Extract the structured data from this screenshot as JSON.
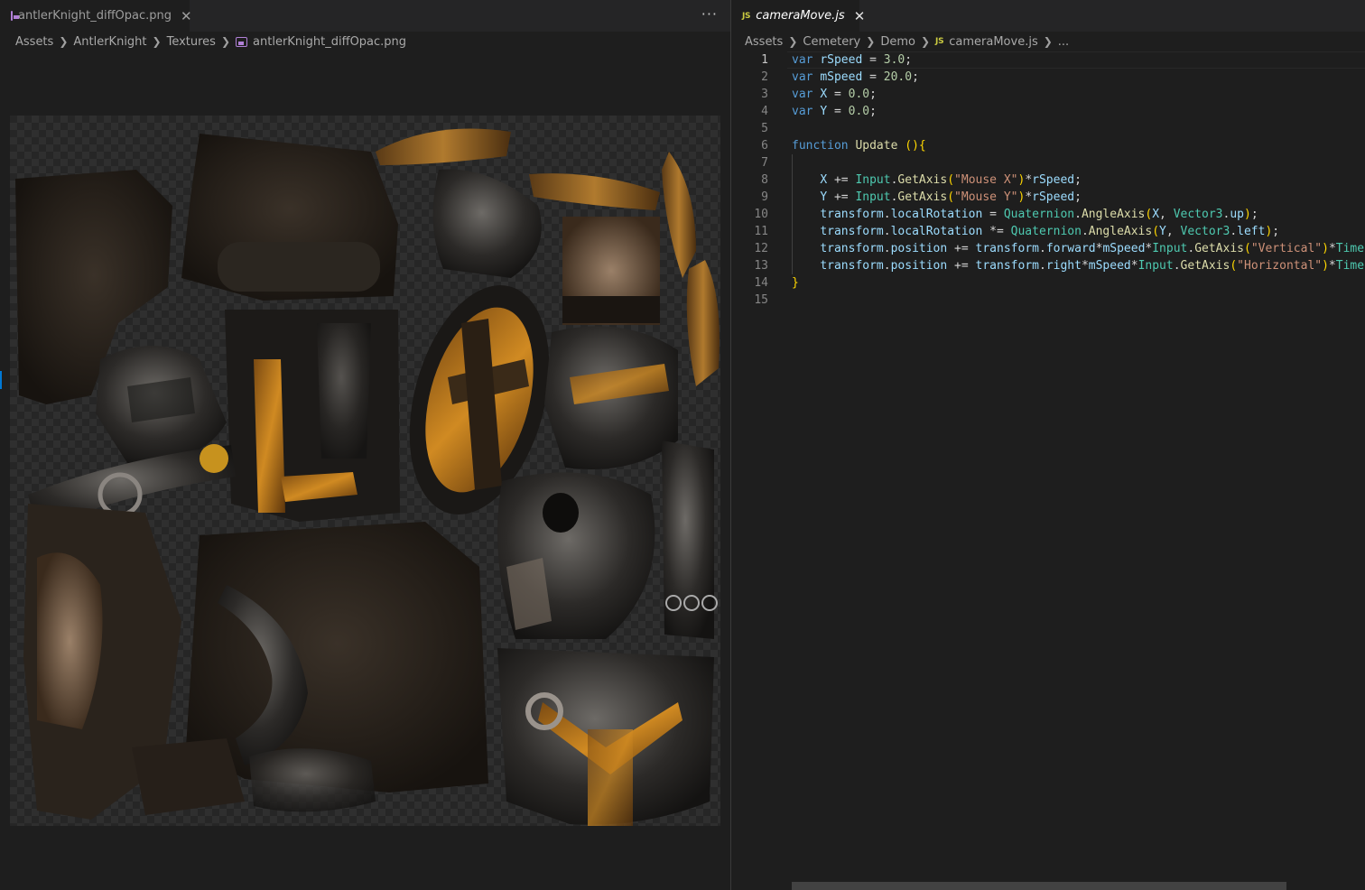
{
  "left_editor": {
    "tab": {
      "label": "antlerKnight_diffOpac.png",
      "icon": "image-file-icon"
    },
    "more_actions": "···",
    "breadcrumb": [
      "Assets",
      "AntlerKnight",
      "Textures",
      "antlerKnight_diffOpac.png"
    ],
    "image_alt": "antler knight diffuse opacity texture atlas"
  },
  "right_editor": {
    "tab": {
      "label": "cameraMove.js",
      "icon": "js-file-icon",
      "icon_text": "JS"
    },
    "breadcrumb": [
      "Assets",
      "Cemetery",
      "Demo",
      "cameraMove.js",
      "..."
    ],
    "active_line": 1,
    "lines": [
      {
        "num": "1",
        "text": "var rSpeed = 3.0;"
      },
      {
        "num": "2",
        "text": "var mSpeed = 20.0;"
      },
      {
        "num": "3",
        "text": "var X = 0.0;"
      },
      {
        "num": "4",
        "text": "var Y = 0.0;"
      },
      {
        "num": "5",
        "text": ""
      },
      {
        "num": "6",
        "text": "function Update (){"
      },
      {
        "num": "7",
        "text": ""
      },
      {
        "num": "8",
        "text": "    X += Input.GetAxis(\"Mouse X\")*rSpeed;"
      },
      {
        "num": "9",
        "text": "    Y += Input.GetAxis(\"Mouse Y\")*rSpeed;"
      },
      {
        "num": "10",
        "text": "    transform.localRotation = Quaternion.AngleAxis(X, Vector3.up);"
      },
      {
        "num": "11",
        "text": "    transform.localRotation *= Quaternion.AngleAxis(Y, Vector3.left);"
      },
      {
        "num": "12",
        "text": "    transform.position += transform.forward*mSpeed*Input.GetAxis(\"Vertical\")*Time.d"
      },
      {
        "num": "13",
        "text": "    transform.position += transform.right*mSpeed*Input.GetAxis(\"Horizontal\")*Time.d"
      },
      {
        "num": "14",
        "text": "}"
      },
      {
        "num": "15",
        "text": ""
      }
    ]
  },
  "colors": {
    "editor_bg": "#1e1e1e",
    "tabbar_bg": "#252526",
    "keyword": "#569cd6",
    "variable": "#9cdcfe",
    "number": "#b5cea8",
    "function": "#dcdcaa",
    "string": "#ce9178",
    "type": "#4ec9b0",
    "bracket": "#ffd700",
    "image_icon": "#b180d7",
    "js_icon": "#cbcb41"
  }
}
